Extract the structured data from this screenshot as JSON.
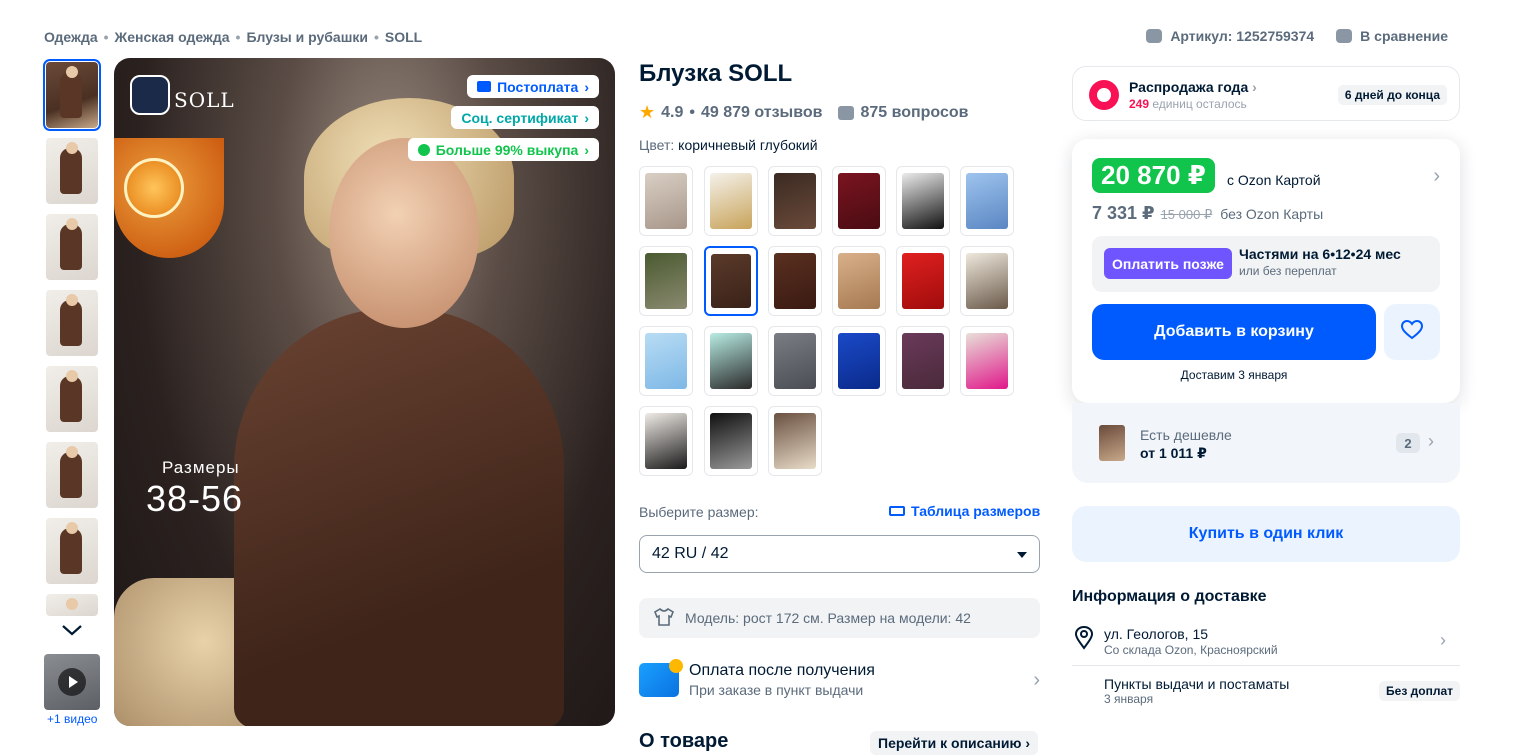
{
  "breadcrumb": [
    "Одежда",
    "Женская одежда",
    "Блузы и рубашки",
    "SOLL"
  ],
  "breadcrumb_sep": "•",
  "top_actions": {
    "article": "Артикул: 1252759374",
    "compare": "В сравнение"
  },
  "gallery": {
    "video_label": "+1 видео",
    "thumb_count": 8
  },
  "main_image": {
    "brand": "SOLL",
    "badges": [
      "Постоплата",
      "Соц. сертификат",
      "Больше 99% выкупа"
    ],
    "sizes_label": "Размеры",
    "sizes_value": "38-56"
  },
  "product": {
    "title": "Блузка SOLL",
    "rating": "4.9",
    "reviews": "49 879 отзывов",
    "rating_dot": "•",
    "questions": "875 вопросов",
    "color_label": "Цвет:",
    "color_value": "коричневый глубокий"
  },
  "size": {
    "label": "Выберите размер:",
    "table": "Таблица размеров",
    "selected": "42 RU / 42"
  },
  "model_info": "Модель: рост 172 см. Размер на модели: 42",
  "payment_after": {
    "title": "Оплата после получения",
    "subtitle": "При заказе в пункт выдачи"
  },
  "about": {
    "title": "О товаре",
    "link": "Перейти к описанию"
  },
  "sale": {
    "title": "Распродажа года",
    "count": "249",
    "count_text": "единиц осталось",
    "timer": "6 дней до конца"
  },
  "price": {
    "card_price": "20 870 ₽",
    "card_label": "с Ozon Картой",
    "price": "7 331 ₽",
    "old_price": "15 000 ₽",
    "no_card_label": "без Ozon Карты",
    "pay_later_btn": "Оплатить позже",
    "installments": "Частями на 6•12•24 мес",
    "installments_sub": "или без переплат",
    "add_to_cart": "Добавить в корзину",
    "delivery_date": "Доставим 3 января"
  },
  "cheaper": {
    "title": "Есть дешевле",
    "price": "от 1 011 ₽",
    "count": "2"
  },
  "one_click": "Купить в один клик",
  "delivery": {
    "title": "Информация о доставке",
    "address": "ул. Геологов, 15",
    "address_sub": "Со склада Ozon, Красноярский",
    "pickup": "Пункты выдачи и постаматы",
    "pickup_date": "3 января",
    "pickup_badge": "Без доплат"
  },
  "colors": {
    "accent": "#005bff",
    "price_green": "#10c44c",
    "sale_pink": "#f91155",
    "pay_later": "#6e55ff"
  }
}
